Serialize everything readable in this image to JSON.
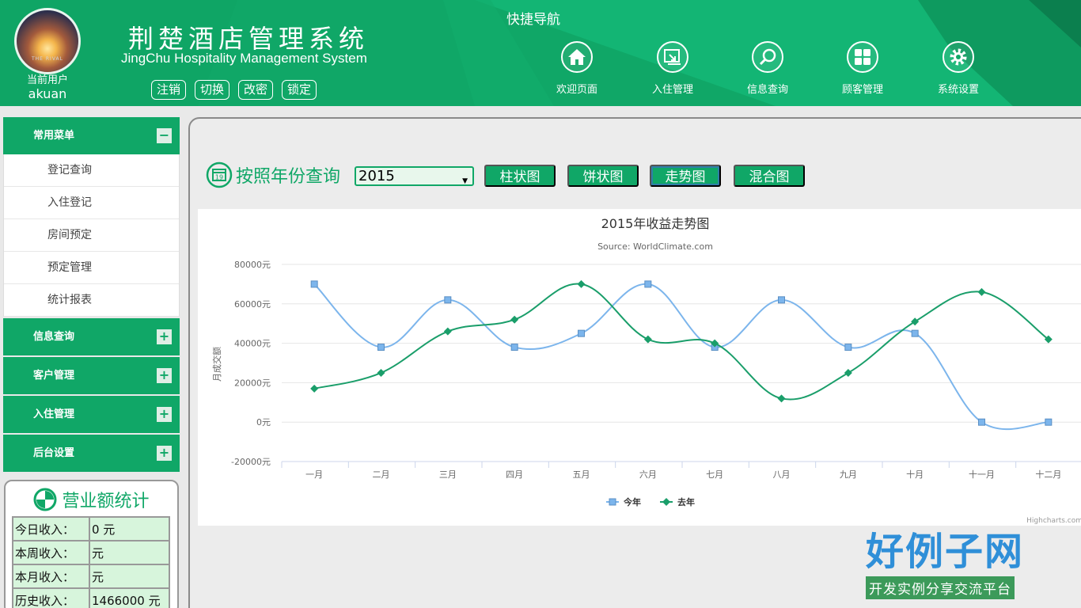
{
  "header": {
    "title": "荆楚酒店管理系统",
    "subtitle": "JingChu Hospitality Management System",
    "user_label": "当前用户",
    "username": "akuan",
    "avatar_text": "THE RIVAL",
    "buttons": [
      "注销",
      "切换",
      "改密",
      "锁定"
    ],
    "quick_nav_title": "快捷导航",
    "quick_nav": [
      {
        "label": "欢迎页面",
        "icon": "home-icon"
      },
      {
        "label": "入住管理",
        "icon": "checkin-icon"
      },
      {
        "label": "信息查询",
        "icon": "search-icon"
      },
      {
        "label": "顾客管理",
        "icon": "grid-icon"
      },
      {
        "label": "系统设置",
        "icon": "gear-icon"
      }
    ]
  },
  "sidebar": {
    "common_menu": "常用菜单",
    "common_items": [
      "登记查询",
      "入住登记",
      "房间预定",
      "预定管理",
      "统计报表"
    ],
    "groups": [
      "信息查询",
      "客户管理",
      "入住管理",
      "后台设置"
    ],
    "collapse_symbol": "−",
    "expand_symbol": "+"
  },
  "stats": {
    "title": "营业额统计",
    "rows": [
      {
        "k": "今日收入：",
        "v": "0 元"
      },
      {
        "k": "本周收入：",
        "v": "元"
      },
      {
        "k": "本月收入：",
        "v": "元"
      },
      {
        "k": "历史收入：",
        "v": "1466000 元"
      }
    ]
  },
  "query": {
    "title": "按照年份查询",
    "calendar_num": "19",
    "year": "2015",
    "arrow": "▼",
    "buttons": [
      "柱状图",
      "饼状图",
      "走势图",
      "混合图"
    ]
  },
  "chart_data": {
    "type": "line",
    "title": "2015年收益走势图",
    "subtitle": "Source: WorldClimate.com",
    "ylabel": "月成交额",
    "xlabel": "",
    "categories": [
      "一月",
      "二月",
      "三月",
      "四月",
      "五月",
      "六月",
      "七月",
      "八月",
      "九月",
      "十月",
      "十一月",
      "十二月"
    ],
    "ylim": [
      -20000,
      80000
    ],
    "yticks": [
      80000,
      60000,
      40000,
      20000,
      0,
      -20000
    ],
    "ytick_labels": [
      "80000元",
      "60000元",
      "40000元",
      "20000元",
      "0元",
      "-20000元"
    ],
    "series": [
      {
        "name": "今年",
        "color": "#7cb5ec",
        "marker": "square",
        "values": [
          70000,
          38000,
          62000,
          38000,
          45000,
          70000,
          38000,
          62000,
          38000,
          45000,
          0,
          0
        ]
      },
      {
        "name": "去年",
        "color": "#1a9e6a",
        "marker": "diamond",
        "values": [
          17000,
          25000,
          46000,
          52000,
          70000,
          42000,
          40000,
          12000,
          25000,
          51000,
          66000,
          42000
        ]
      }
    ],
    "grid": true,
    "legend": "bottom-center",
    "credits": "Highcharts.com"
  },
  "watermark": {
    "logo_main": "好例子网",
    "logo_sub": "开发实例分享交流平台"
  },
  "colors": {
    "brand": "#10a767",
    "header_dark": "#0b8f56",
    "stat_cell": "#d7f5dc"
  }
}
